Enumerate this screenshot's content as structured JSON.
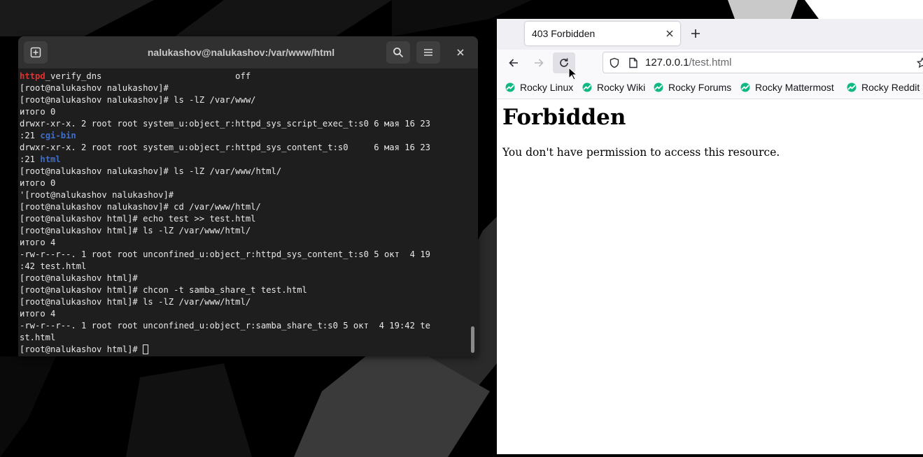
{
  "terminal": {
    "title": "nalukashov@nalukashov:/var/www/html",
    "lines": [
      {
        "segments": [
          {
            "t": "httpd",
            "c": "t-red"
          },
          {
            "t": "_verify_dns                          off"
          }
        ]
      },
      {
        "segments": [
          {
            "t": "[root@nalukashov nalukashov]#"
          }
        ]
      },
      {
        "segments": [
          {
            "t": "[root@nalukashov nalukashov]# ls -lZ /var/www/"
          }
        ]
      },
      {
        "segments": [
          {
            "t": "итого 0"
          }
        ]
      },
      {
        "segments": [
          {
            "t": "drwxr-xr-x. 2 root root system_u:object_r:httpd_sys_script_exec_t:s0 6 мая 16 23"
          }
        ]
      },
      {
        "segments": [
          {
            "t": ":21 "
          },
          {
            "t": "cgi-bin",
            "c": "t-blue"
          }
        ]
      },
      {
        "segments": [
          {
            "t": "drwxr-xr-x. 2 root root system_u:object_r:httpd_sys_content_t:s0     6 мая 16 23"
          }
        ]
      },
      {
        "segments": [
          {
            "t": ":21 "
          },
          {
            "t": "html",
            "c": "t-blue"
          }
        ]
      },
      {
        "segments": [
          {
            "t": "[root@nalukashov nalukashov]# ls -lZ /var/www/html/"
          }
        ]
      },
      {
        "segments": [
          {
            "t": "итого 0"
          }
        ]
      },
      {
        "segments": [
          {
            "t": "'[root@nalukashov nalukashov]#"
          }
        ]
      },
      {
        "segments": [
          {
            "t": "[root@nalukashov nalukashov]# cd /var/www/html/"
          }
        ]
      },
      {
        "segments": [
          {
            "t": "[root@nalukashov html]# echo test >> test.html"
          }
        ]
      },
      {
        "segments": [
          {
            "t": "[root@nalukashov html]# ls -lZ /var/www/html/"
          }
        ]
      },
      {
        "segments": [
          {
            "t": "итого 4"
          }
        ]
      },
      {
        "segments": [
          {
            "t": "-rw-r--r--. 1 root root unconfined_u:object_r:httpd_sys_content_t:s0 5 окт  4 19"
          }
        ]
      },
      {
        "segments": [
          {
            "t": ":42 test.html"
          }
        ]
      },
      {
        "segments": [
          {
            "t": "[root@nalukashov html]#"
          }
        ]
      },
      {
        "segments": [
          {
            "t": "[root@nalukashov html]# chcon -t samba_share_t test.html"
          }
        ]
      },
      {
        "segments": [
          {
            "t": "[root@nalukashov html]# ls -lZ /var/www/html/"
          }
        ]
      },
      {
        "segments": [
          {
            "t": "итого 4"
          }
        ]
      },
      {
        "segments": [
          {
            "t": "-rw-r--r--. 1 root root unconfined_u:object_r:samba_share_t:s0 5 окт  4 19:42 te"
          }
        ]
      },
      {
        "segments": [
          {
            "t": "st.html"
          }
        ]
      },
      {
        "segments": [
          {
            "t": "[root@nalukashov html]# "
          }
        ],
        "cursor": true
      }
    ],
    "icons": {
      "new_tab": "new-tab-icon",
      "search": "search-icon",
      "menu": "hamburger-menu-icon",
      "close": "close-icon"
    }
  },
  "browser": {
    "tab_title": "403 Forbidden",
    "url_host": "127.0.0.1",
    "url_path": "/test.html",
    "bookmarks": [
      "Rocky Linux",
      "Rocky Wiki",
      "Rocky Forums",
      "Rocky Mattermost",
      "Rocky Reddit"
    ],
    "page_heading": "Forbidden",
    "page_message": "You don't have permission to access this resource.",
    "colors": {
      "bookmark_icon": "#10b981",
      "tabbar_bg": "#f0f0f4"
    }
  }
}
